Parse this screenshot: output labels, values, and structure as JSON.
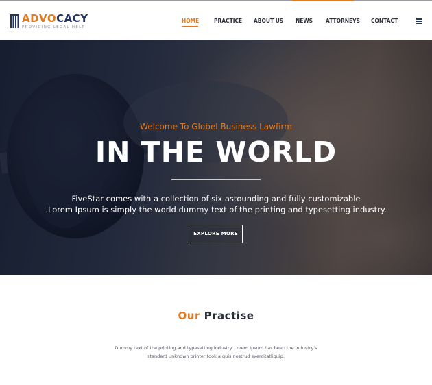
{
  "header": {
    "logo": {
      "name_part1": "ADVO",
      "name_part2": "CACY",
      "tagline": "PROVIDING LEGAL HELP",
      "icon": "columns-icon"
    },
    "nav": [
      {
        "label": "HOME",
        "active": true
      },
      {
        "label": "PRACTICE",
        "active": false
      },
      {
        "label": "ABOUT US",
        "active": false
      },
      {
        "label": "NEWS",
        "active": false
      },
      {
        "label": "ATTORNEYS",
        "active": false
      },
      {
        "label": "CONTACT",
        "active": false
      }
    ],
    "menu_icon": "hamburger-icon"
  },
  "hero": {
    "welcome": "Welcome To Globel Business Lawfirm",
    "title": "IN THE WORLD",
    "description_line1": "FiveStar comes with a collection of six astounding and fully customizable",
    "description_line2": ".Lorem Ipsum is simply the world dummy text of the printing and typesetting industry.",
    "button_label": "EXPLORE MORE"
  },
  "practise": {
    "title_accent": "Our",
    "title_rest": "Practise",
    "description_line1": "Dummy text of the printing and typesetting industry. Lorem Ipsum has been the industry's",
    "description_line2": "standard unknown printer took a quis nostrud exercitatliquip."
  },
  "colors": {
    "accent": "#e07b22",
    "brand_dark": "#24355f",
    "text_dark": "#2b2f3a"
  }
}
